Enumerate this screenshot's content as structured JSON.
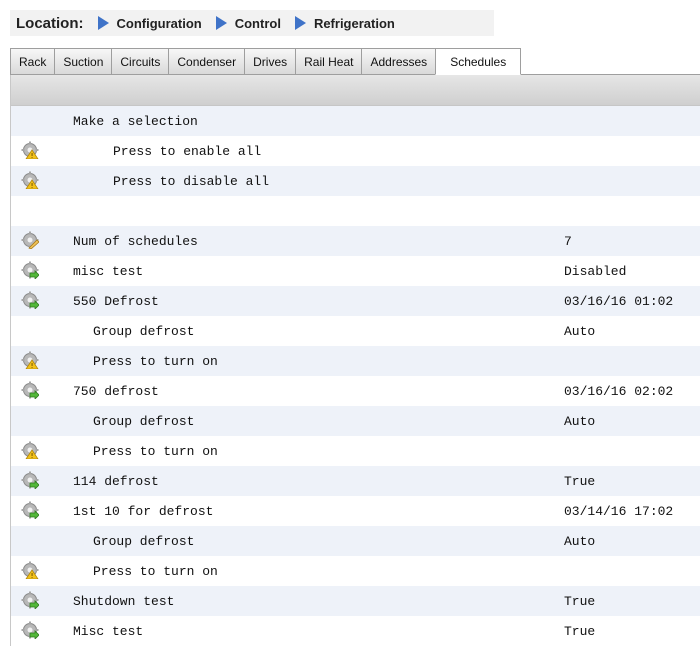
{
  "location": {
    "label": "Location:",
    "crumbs": [
      "Configuration",
      "Control",
      "Refrigeration"
    ]
  },
  "tabs": [
    "Rack",
    "Suction",
    "Circuits",
    "Condenser",
    "Drives",
    "Rail Heat",
    "Addresses",
    "Schedules"
  ],
  "active_tab": "Schedules",
  "rows": [
    {
      "icon": "none",
      "label": "Make a selection",
      "indent": 0,
      "value": ""
    },
    {
      "icon": "warning-gear-icon",
      "label": "Press to enable all",
      "indent": 2,
      "value": ""
    },
    {
      "icon": "warning-gear-icon",
      "label": "Press to disable all",
      "indent": 2,
      "value": ""
    },
    {
      "icon": "none",
      "label": "",
      "indent": 0,
      "value": ""
    },
    {
      "icon": "edit-gear-icon",
      "label": "Num of schedules",
      "indent": 0,
      "value": "7"
    },
    {
      "icon": "arrow-gear-icon",
      "label": "misc test",
      "indent": 0,
      "value": "Disabled"
    },
    {
      "icon": "arrow-gear-icon",
      "label": "550 Defrost",
      "indent": 0,
      "value": "03/16/16 01:02"
    },
    {
      "icon": "none",
      "label": "Group defrost",
      "indent": 1,
      "value": "Auto"
    },
    {
      "icon": "warning-gear-icon",
      "label": "Press to turn on",
      "indent": 1,
      "value": ""
    },
    {
      "icon": "arrow-gear-icon",
      "label": "750 defrost",
      "indent": 0,
      "value": "03/16/16 02:02"
    },
    {
      "icon": "none",
      "label": "Group defrost",
      "indent": 1,
      "value": "Auto"
    },
    {
      "icon": "warning-gear-icon",
      "label": "Press to turn on",
      "indent": 1,
      "value": ""
    },
    {
      "icon": "arrow-gear-icon",
      "label": "114 defrost",
      "indent": 0,
      "value": "True"
    },
    {
      "icon": "arrow-gear-icon",
      "label": "1st 10 for defrost",
      "indent": 0,
      "value": "03/14/16 17:02"
    },
    {
      "icon": "none",
      "label": "Group defrost",
      "indent": 1,
      "value": "Auto"
    },
    {
      "icon": "warning-gear-icon",
      "label": "Press to turn on",
      "indent": 1,
      "value": ""
    },
    {
      "icon": "arrow-gear-icon",
      "label": "Shutdown test",
      "indent": 0,
      "value": "True"
    },
    {
      "icon": "arrow-gear-icon",
      "label": "Misc test",
      "indent": 0,
      "value": "True"
    }
  ]
}
